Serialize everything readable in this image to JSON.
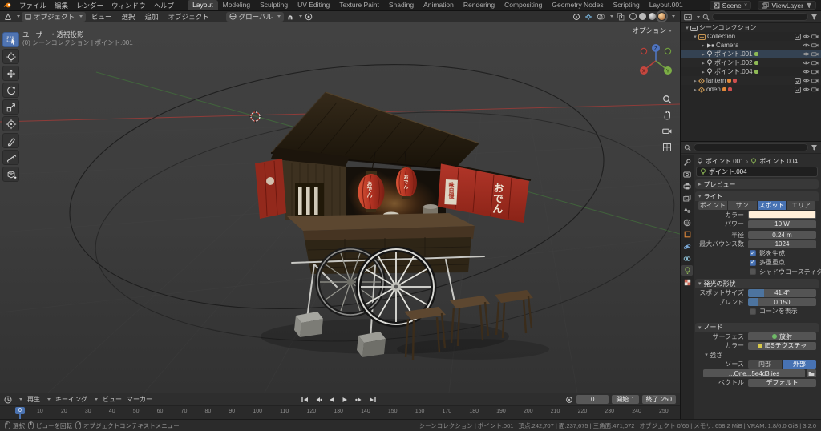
{
  "topbar": {
    "menus": [
      "ファイル",
      "編集",
      "レンダー",
      "ウィンドウ",
      "ヘルプ"
    ],
    "workspaces": [
      "Layout",
      "Modeling",
      "Sculpting",
      "UV Editing",
      "Texture Paint",
      "Shading",
      "Animation",
      "Rendering",
      "Compositing",
      "Geometry Nodes",
      "Scripting",
      "Layout.001"
    ],
    "scene_label": "Scene",
    "viewlayer_label": "ViewLayer"
  },
  "vp_header": {
    "mode": "オブジェクト",
    "menu_view": "ビュー",
    "menu_select": "選択",
    "menu_add": "追加",
    "menu_object": "オブジェクト",
    "orientation": "グローバル"
  },
  "viewport": {
    "options": "オプション",
    "view_label": "ユーザー・透視投影",
    "context_label": "(0) シーンコレクション | ポイント.001"
  },
  "scene": {
    "noren_text": "おでん",
    "lantern_text": "おでん",
    "sign_text": "味自慢"
  },
  "outliner": {
    "root": "シーンコレクション",
    "rows": [
      {
        "label": "Collection"
      },
      {
        "label": "Camera"
      },
      {
        "label": "ポイント.001"
      },
      {
        "label": "ポイント.002"
      },
      {
        "label": "ポイント.004"
      },
      {
        "label": "lantern"
      },
      {
        "label": "oden"
      }
    ]
  },
  "props": {
    "breadcrumb1": "ポイント.001",
    "breadcrumb2": "ポイント.004",
    "name": "ポイント.004",
    "sec_preview": "プレビュー",
    "sec_light": "ライト",
    "type_point": "ポイント",
    "type_sun": "サン",
    "type_spot": "スポット",
    "type_area": "エリア",
    "lbl_color": "カラー",
    "lbl_power": "パワー",
    "val_power": "10 W",
    "lbl_radius": "半径",
    "val_radius": "0.24 m",
    "lbl_bounces": "最大バウンス数",
    "val_bounces": "1024",
    "chk_shadow": "影を生成",
    "chk_mis": "多重重点",
    "chk_caustics": "シャドウコースティクス",
    "sec_beam": "発光の形状",
    "lbl_spotsize": "スポットサイズ",
    "val_spotsize": "41.4°",
    "lbl_blend": "ブレンド",
    "val_blend": "0.150",
    "chk_cone": "コーンを表示",
    "sec_nodes": "ノード",
    "lbl_surface": "サーフェス",
    "val_surface": "放射",
    "lbl_ncolor": "カラー",
    "val_ncolor": "IESテクスチャ",
    "lbl_strength": "強さ",
    "lbl_source": "ソース",
    "src_internal": "内部",
    "src_external": "外部",
    "val_file": "...One...5e4d3.ies",
    "lbl_vector": "ベクトル",
    "val_vector": "デフォルト",
    "accent_color": "#4772b3"
  },
  "timeline": {
    "menu_play": "再生",
    "menu_keying": "キーイング",
    "menu_view": "ビュー",
    "menu_marker": "マーカー",
    "current": "0",
    "marker": "0",
    "lbl_start": "開始",
    "val_start": "1",
    "lbl_end": "終了",
    "val_end": "250",
    "ticks": [
      "0",
      "10",
      "20",
      "30",
      "40",
      "50",
      "60",
      "70",
      "80",
      "90",
      "100",
      "110",
      "120",
      "130",
      "140",
      "150",
      "160",
      "170",
      "180",
      "190",
      "200",
      "210",
      "220",
      "230",
      "240",
      "250"
    ]
  },
  "statusbar": {
    "hint_select": "選択",
    "hint_rotate": "ビューを回転",
    "hint_context": "オブジェクトコンテキストメニュー",
    "stats": "シーンコレクション | ポイント.001 | 頂点:242,707 | 面:237,675 | 三角面:471,072 | オブジェクト 0/66 | メモリ: 658.2 MiB | VRAM: 1.8/6.0 GiB | 3.2.0"
  }
}
